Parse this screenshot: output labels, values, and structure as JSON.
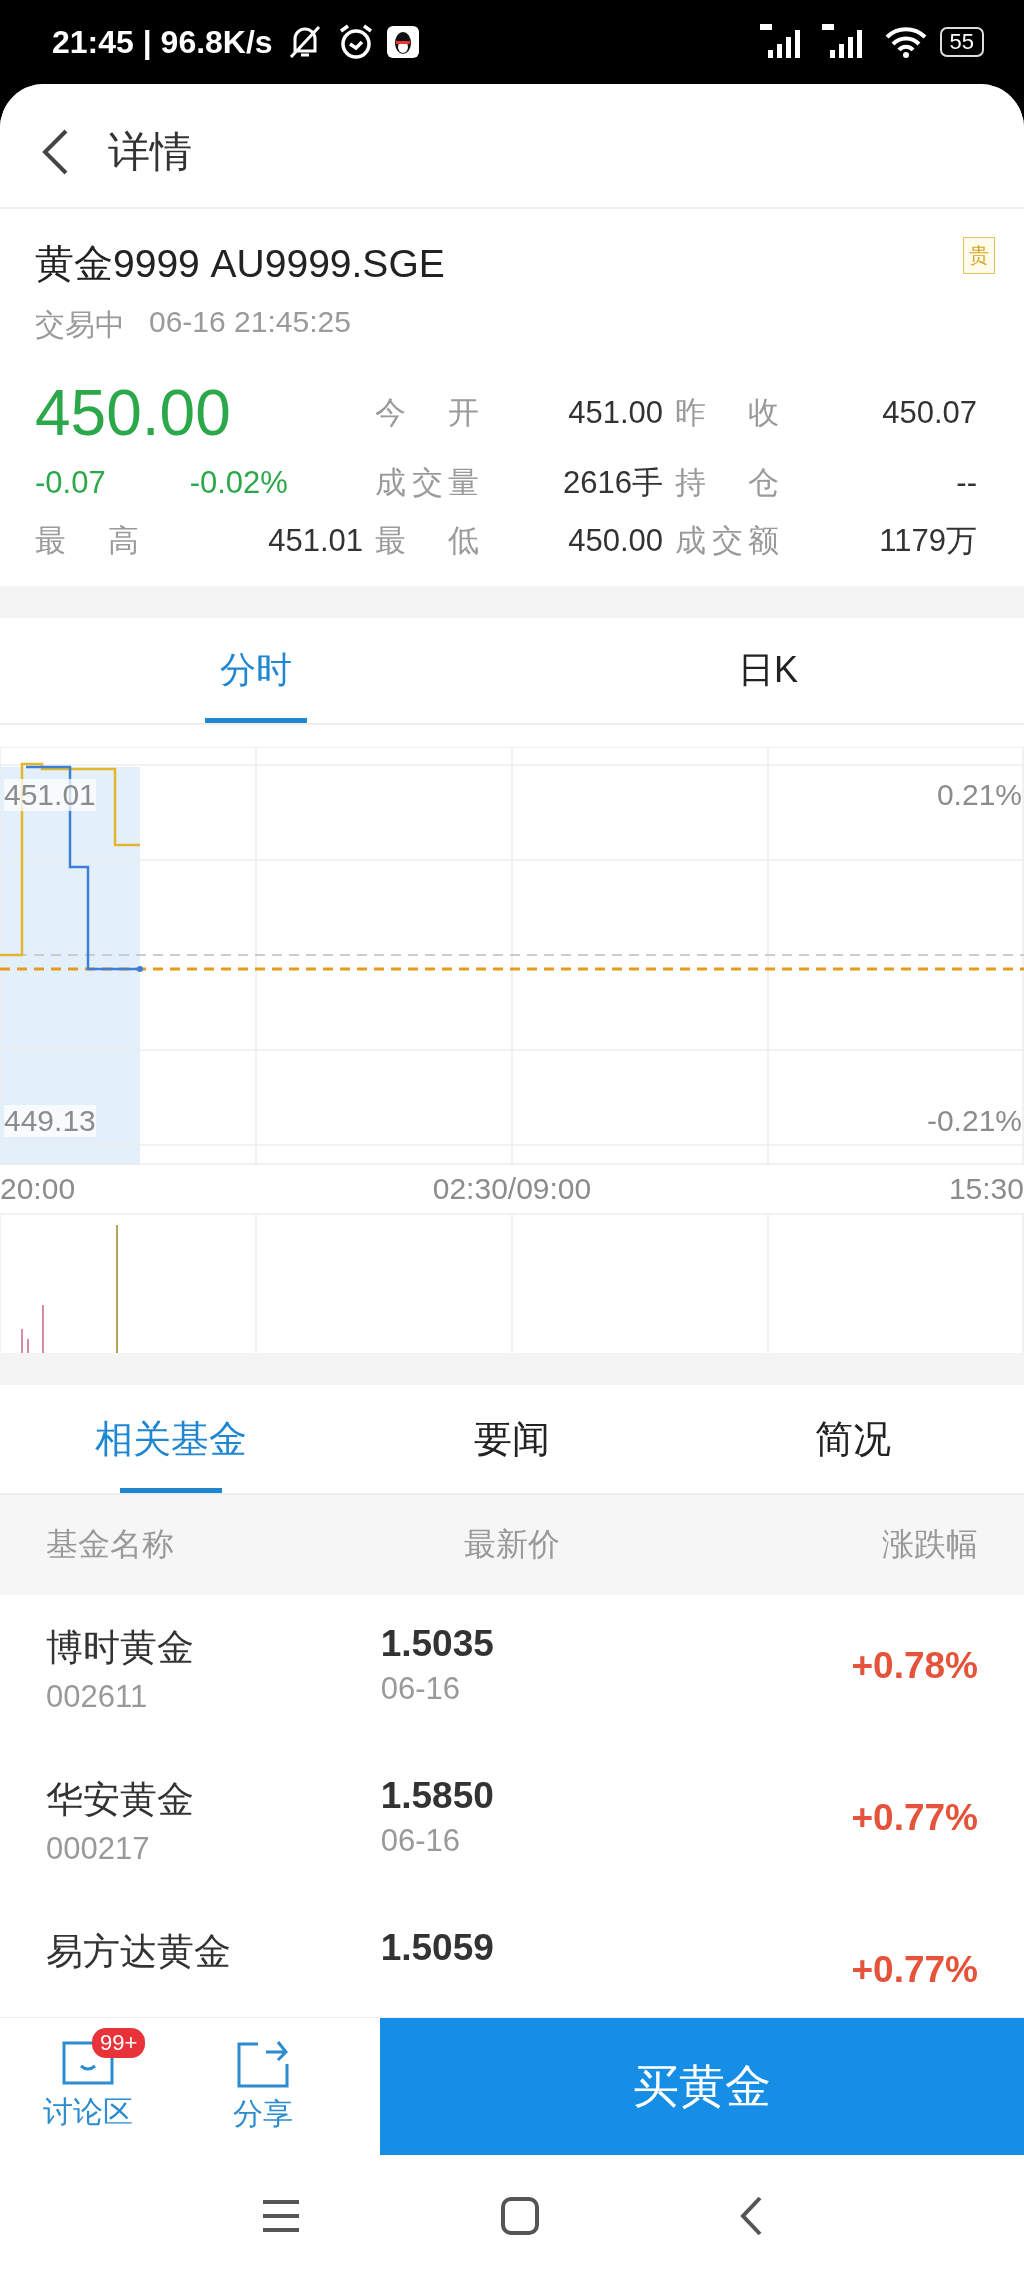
{
  "status_bar": {
    "time": "21:45 | 96.8K/s",
    "battery": "55"
  },
  "header": {
    "title": "详情"
  },
  "quote": {
    "name": "黄金9999 AU9999.SGE",
    "badge": "贵",
    "status": "交易中",
    "time": "06-16 21:45:25",
    "price": "450.00",
    "change": "-0.07",
    "change_pct": "-0.02%",
    "color": "#2ba84a",
    "stats": [
      {
        "label": "今 开",
        "value": "451.00"
      },
      {
        "label": "昨 收",
        "value": "450.07"
      },
      {
        "label": "成交量",
        "value": "2616手"
      },
      {
        "label": "持 仓",
        "value": "--"
      },
      {
        "label": "最 高",
        "value": "451.01"
      },
      {
        "label": "最 低",
        "value": "450.00"
      },
      {
        "label": "成交额",
        "value": "1179万"
      }
    ]
  },
  "chart_tabs": [
    {
      "label": "分时",
      "selected": true
    },
    {
      "label": "日K",
      "selected": false
    }
  ],
  "chart": {
    "price_high": "451.01",
    "price_low": "449.13",
    "pct_high": "0.21%",
    "pct_low": "-0.21%",
    "time_labels": [
      "20:00",
      "02:30/09:00",
      "15:30"
    ]
  },
  "info_tabs": [
    {
      "label": "相关基金",
      "selected": true
    },
    {
      "label": "要闻",
      "selected": false
    },
    {
      "label": "简况",
      "selected": false
    }
  ],
  "fund_table": {
    "columns": [
      "基金名称",
      "最新价",
      "涨跌幅"
    ],
    "rows": [
      {
        "name": "博时黄金",
        "code": "002611",
        "price": "1.5035",
        "date": "06-16",
        "change": "+0.78%",
        "color": "#e5533a"
      },
      {
        "name": "华安黄金",
        "code": "000217",
        "price": "1.5850",
        "date": "06-16",
        "change": "+0.77%",
        "color": "#e5533a"
      },
      {
        "name": "易方达黄金",
        "price": "1.5059",
        "change": "+0.77%",
        "color": "#e5533a"
      }
    ]
  },
  "bottom_bar": {
    "actions": [
      {
        "kind": "chat",
        "label": "讨论区",
        "badge": "99+"
      },
      {
        "kind": "share",
        "label": "分享"
      }
    ],
    "buy_button": "买黄金"
  }
}
